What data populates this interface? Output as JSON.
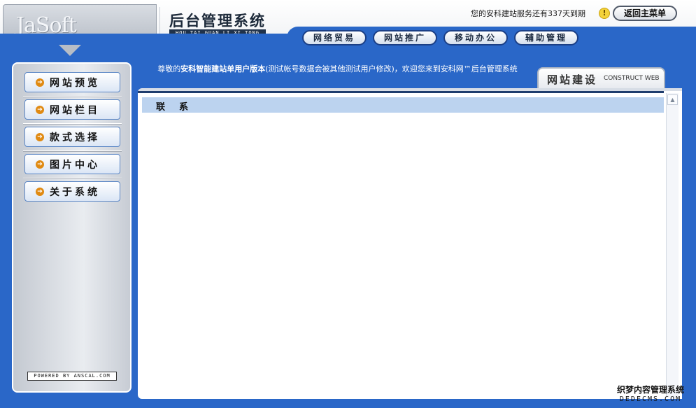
{
  "header": {
    "logo": "JaSoft",
    "title": "后台管理系统",
    "subtitle": "HOU TAI GUAN LI XI TONG",
    "service_note": "您的安科建站服务还有337天到期",
    "warn_glyph": "!",
    "back_label": "返回主菜单"
  },
  "nav": [
    {
      "label": "网络贸易"
    },
    {
      "label": "网站推广"
    },
    {
      "label": "移动办公"
    },
    {
      "label": "辅助管理"
    }
  ],
  "sidebar": {
    "items": [
      {
        "label": "网站预览",
        "icon": "arrow-right-circle-icon"
      },
      {
        "label": "网站栏目",
        "icon": "arrow-right-circle-icon"
      },
      {
        "label": "款式选择",
        "icon": "arrow-right-circle-icon"
      },
      {
        "label": "图片中心",
        "icon": "arrow-right-circle-icon"
      },
      {
        "label": "关于系统",
        "icon": "arrow-right-circle-icon"
      }
    ],
    "icon_glyph": "➔",
    "powered": "POWERED BY ANSCAL.COM"
  },
  "welcome": {
    "prefix": "尊敬的",
    "bold": "安科智能建站单用户版本",
    "suffix": "(测试帐号数据会被其他测试用户修改)，欢迎您来到安科网™后台管理系统"
  },
  "tab": {
    "title_cn": "网站建设",
    "title_en": "CONSTRUCT WEB"
  },
  "content": {
    "row_label": "联系"
  },
  "scroll": {
    "up_glyph": "▲"
  },
  "watermark": {
    "line1": "织梦内容管理系统",
    "line2": "DEDECMS.COM"
  },
  "colors": {
    "brand_blue": "#2a67c8",
    "row_highlight": "#bcd3ef",
    "icon_orange": "#e08a12"
  }
}
